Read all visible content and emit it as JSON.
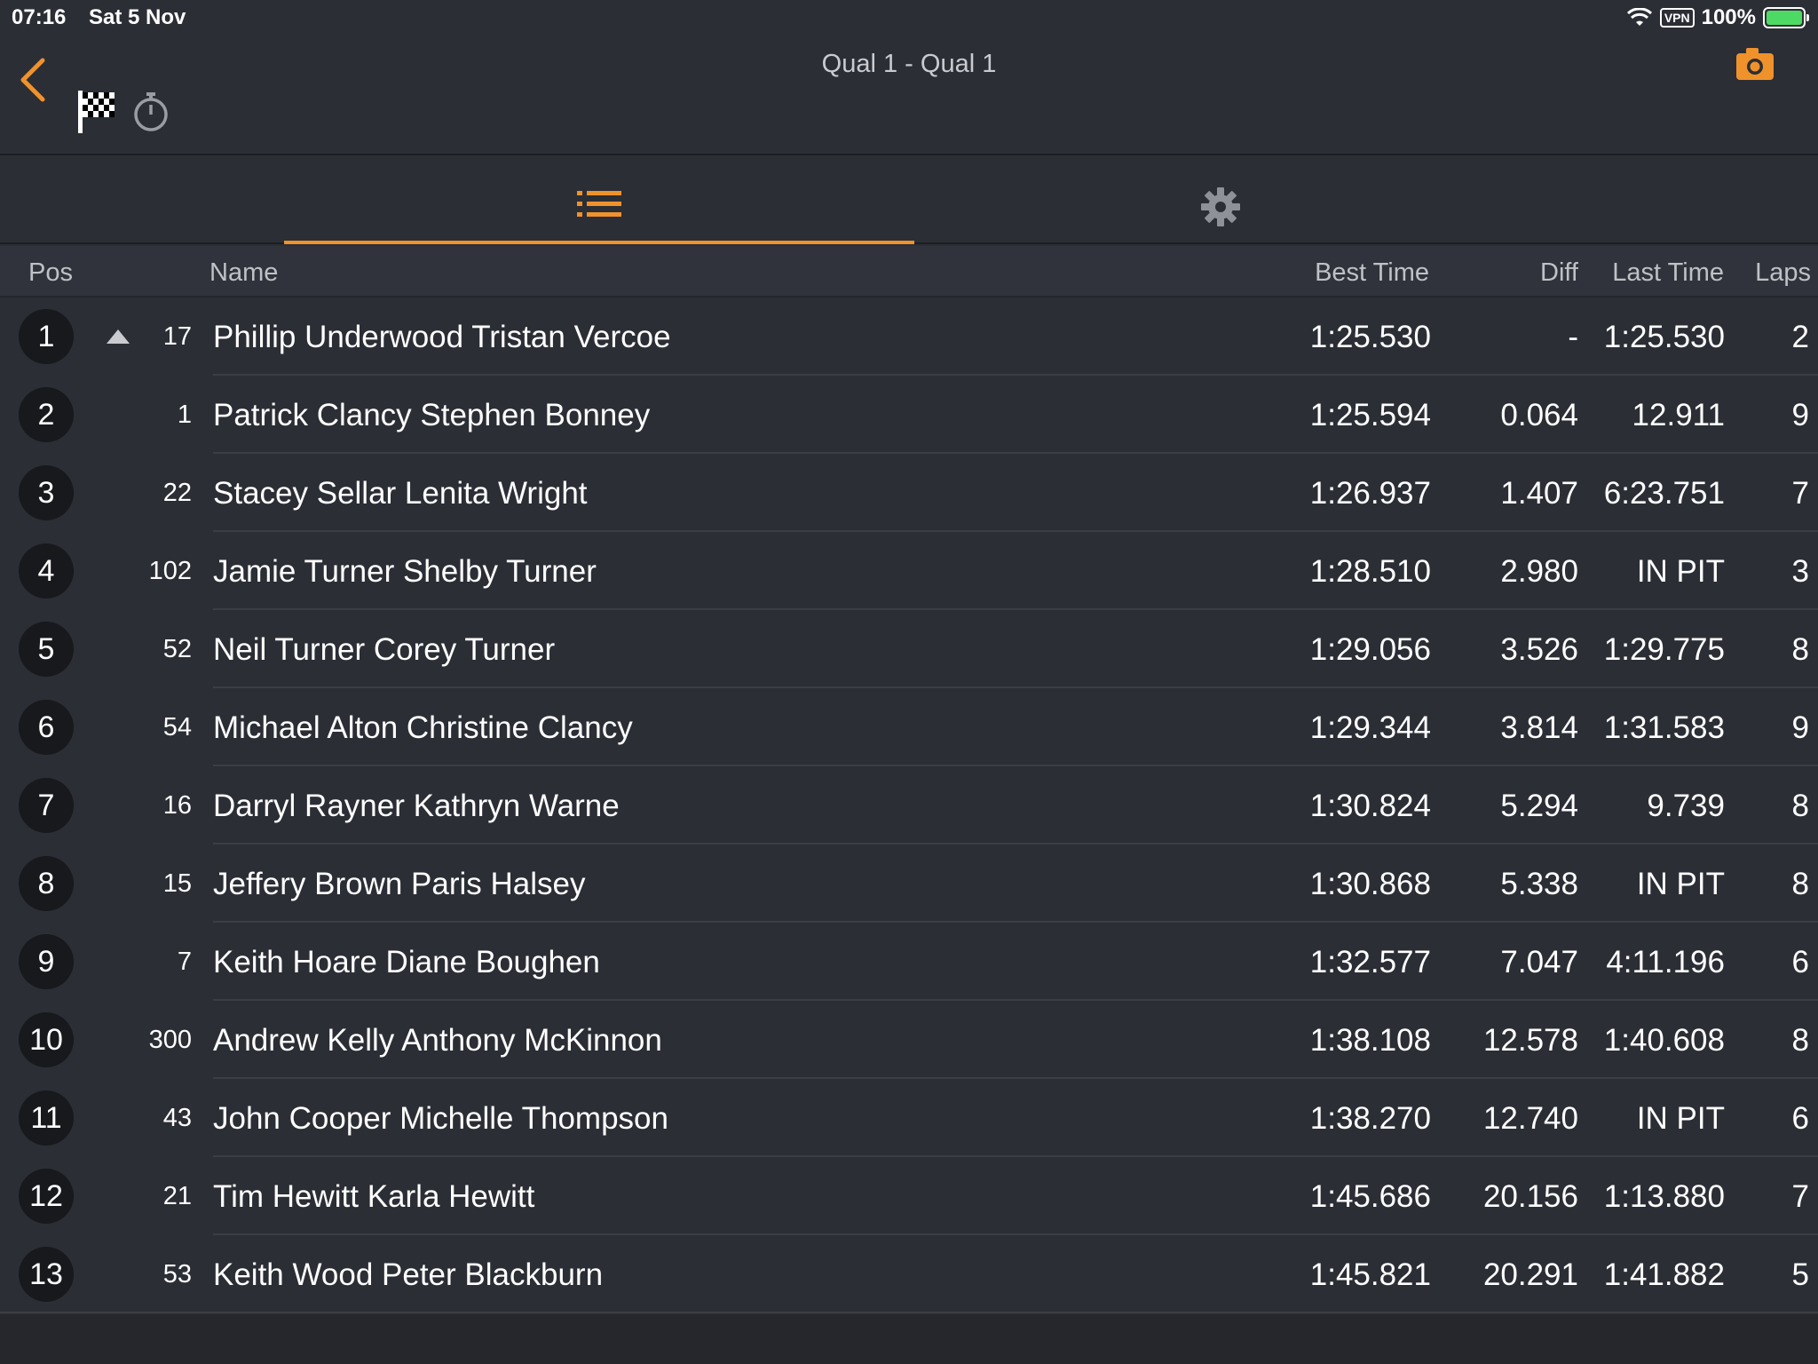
{
  "status_bar": {
    "time": "07:16",
    "date": "Sat 5 Nov",
    "vpn": "VPN",
    "battery": "100%"
  },
  "header": {
    "title": "Qual 1 -  Qual 1",
    "accent_color": "#f0922b"
  },
  "columns": {
    "pos": "Pos",
    "name": "Name",
    "best_time": "Best Time",
    "diff": "Diff",
    "last_time": "Last Time",
    "laps": "Laps"
  },
  "rows": [
    {
      "pos": "1",
      "trend": "up",
      "car": "17",
      "name": "Phillip Underwood Tristan Vercoe",
      "best": "1:25.530",
      "diff": "-",
      "last": "1:25.530",
      "laps": "2"
    },
    {
      "pos": "2",
      "car": "1",
      "name": "Patrick Clancy Stephen Bonney",
      "best": "1:25.594",
      "diff": "0.064",
      "last": "12.911",
      "laps": "9"
    },
    {
      "pos": "3",
      "car": "22",
      "name": "Stacey Sellar Lenita Wright",
      "best": "1:26.937",
      "diff": "1.407",
      "last": "6:23.751",
      "laps": "7"
    },
    {
      "pos": "4",
      "car": "102",
      "name": "Jamie Turner Shelby Turner",
      "best": "1:28.510",
      "diff": "2.980",
      "last": "IN PIT",
      "laps": "3"
    },
    {
      "pos": "5",
      "car": "52",
      "name": "Neil Turner Corey Turner",
      "best": "1:29.056",
      "diff": "3.526",
      "last": "1:29.775",
      "laps": "8"
    },
    {
      "pos": "6",
      "car": "54",
      "name": "Michael Alton Christine Clancy",
      "best": "1:29.344",
      "diff": "3.814",
      "last": "1:31.583",
      "laps": "9"
    },
    {
      "pos": "7",
      "car": "16",
      "name": "Darryl Rayner Kathryn Warne",
      "best": "1:30.824",
      "diff": "5.294",
      "last": "9.739",
      "laps": "8"
    },
    {
      "pos": "8",
      "car": "15",
      "name": "Jeffery Brown Paris Halsey",
      "best": "1:30.868",
      "diff": "5.338",
      "last": "IN PIT",
      "laps": "8"
    },
    {
      "pos": "9",
      "car": "7",
      "name": "Keith Hoare Diane Boughen",
      "best": "1:32.577",
      "diff": "7.047",
      "last": "4:11.196",
      "laps": "6"
    },
    {
      "pos": "10",
      "car": "300",
      "name": "Andrew Kelly Anthony McKinnon",
      "best": "1:38.108",
      "diff": "12.578",
      "last": "1:40.608",
      "laps": "8"
    },
    {
      "pos": "11",
      "car": "43",
      "name": "John Cooper Michelle Thompson",
      "best": "1:38.270",
      "diff": "12.740",
      "last": "IN PIT",
      "laps": "6"
    },
    {
      "pos": "12",
      "car": "21",
      "name": "Tim Hewitt Karla Hewitt",
      "best": "1:45.686",
      "diff": "20.156",
      "last": "1:13.880",
      "laps": "7"
    },
    {
      "pos": "13",
      "car": "53",
      "name": "Keith Wood Peter Blackburn",
      "best": "1:45.821",
      "diff": "20.291",
      "last": "1:41.882",
      "laps": "5"
    }
  ]
}
